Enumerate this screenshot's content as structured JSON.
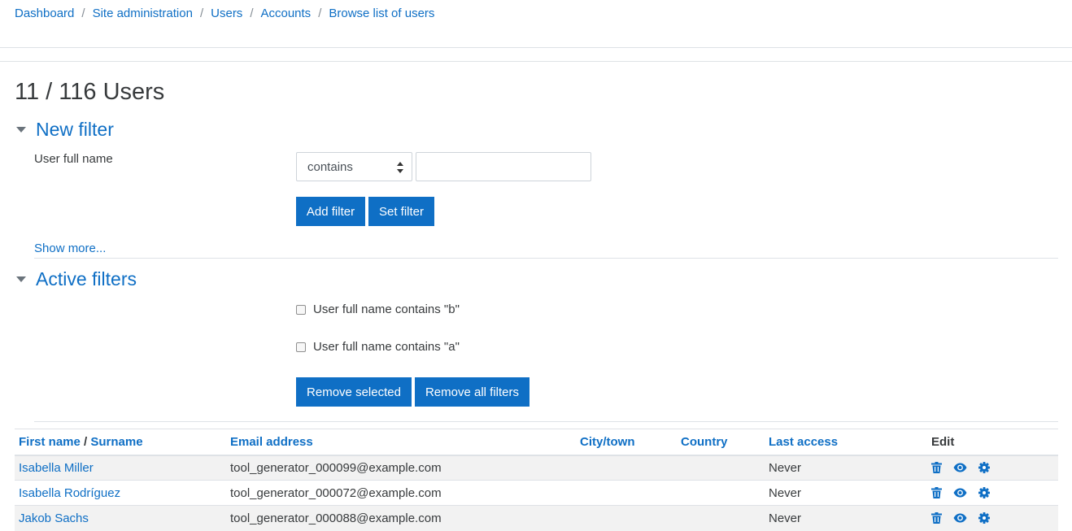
{
  "breadcrumb": [
    "Dashboard",
    "Site administration",
    "Users",
    "Accounts",
    "Browse list of users"
  ],
  "page_title": "11 / 116 Users",
  "new_filter": {
    "title": "New filter",
    "field_label": "User full name",
    "operator_value": "contains",
    "text_value": "",
    "add_button": "Add filter",
    "set_button": "Set filter",
    "show_more": "Show more..."
  },
  "active_filters": {
    "title": "Active filters",
    "items": [
      "User full name contains \"b\"",
      "User full name contains \"a\""
    ],
    "remove_selected": "Remove selected",
    "remove_all": "Remove all filters"
  },
  "table": {
    "headers": {
      "first_name": "First name",
      "slash": " / ",
      "surname": "Surname",
      "email": "Email address",
      "city": "City/town",
      "country": "Country",
      "last_access": "Last access",
      "edit": "Edit"
    },
    "rows": [
      {
        "name": "Isabella Miller",
        "email": "tool_generator_000099@example.com",
        "city": "",
        "country": "",
        "last_access": "Never"
      },
      {
        "name": "Isabella Rodríguez",
        "email": "tool_generator_000072@example.com",
        "city": "",
        "country": "",
        "last_access": "Never"
      },
      {
        "name": "Jakob Sachs",
        "email": "tool_generator_000088@example.com",
        "city": "",
        "country": "",
        "last_access": "Never"
      }
    ],
    "row_icons": [
      "trash-icon",
      "eye-icon",
      "gear-icon"
    ]
  },
  "colors": {
    "accent": "#0f6fc5",
    "text": "#373a3c",
    "stripe": "#f2f2f2"
  }
}
